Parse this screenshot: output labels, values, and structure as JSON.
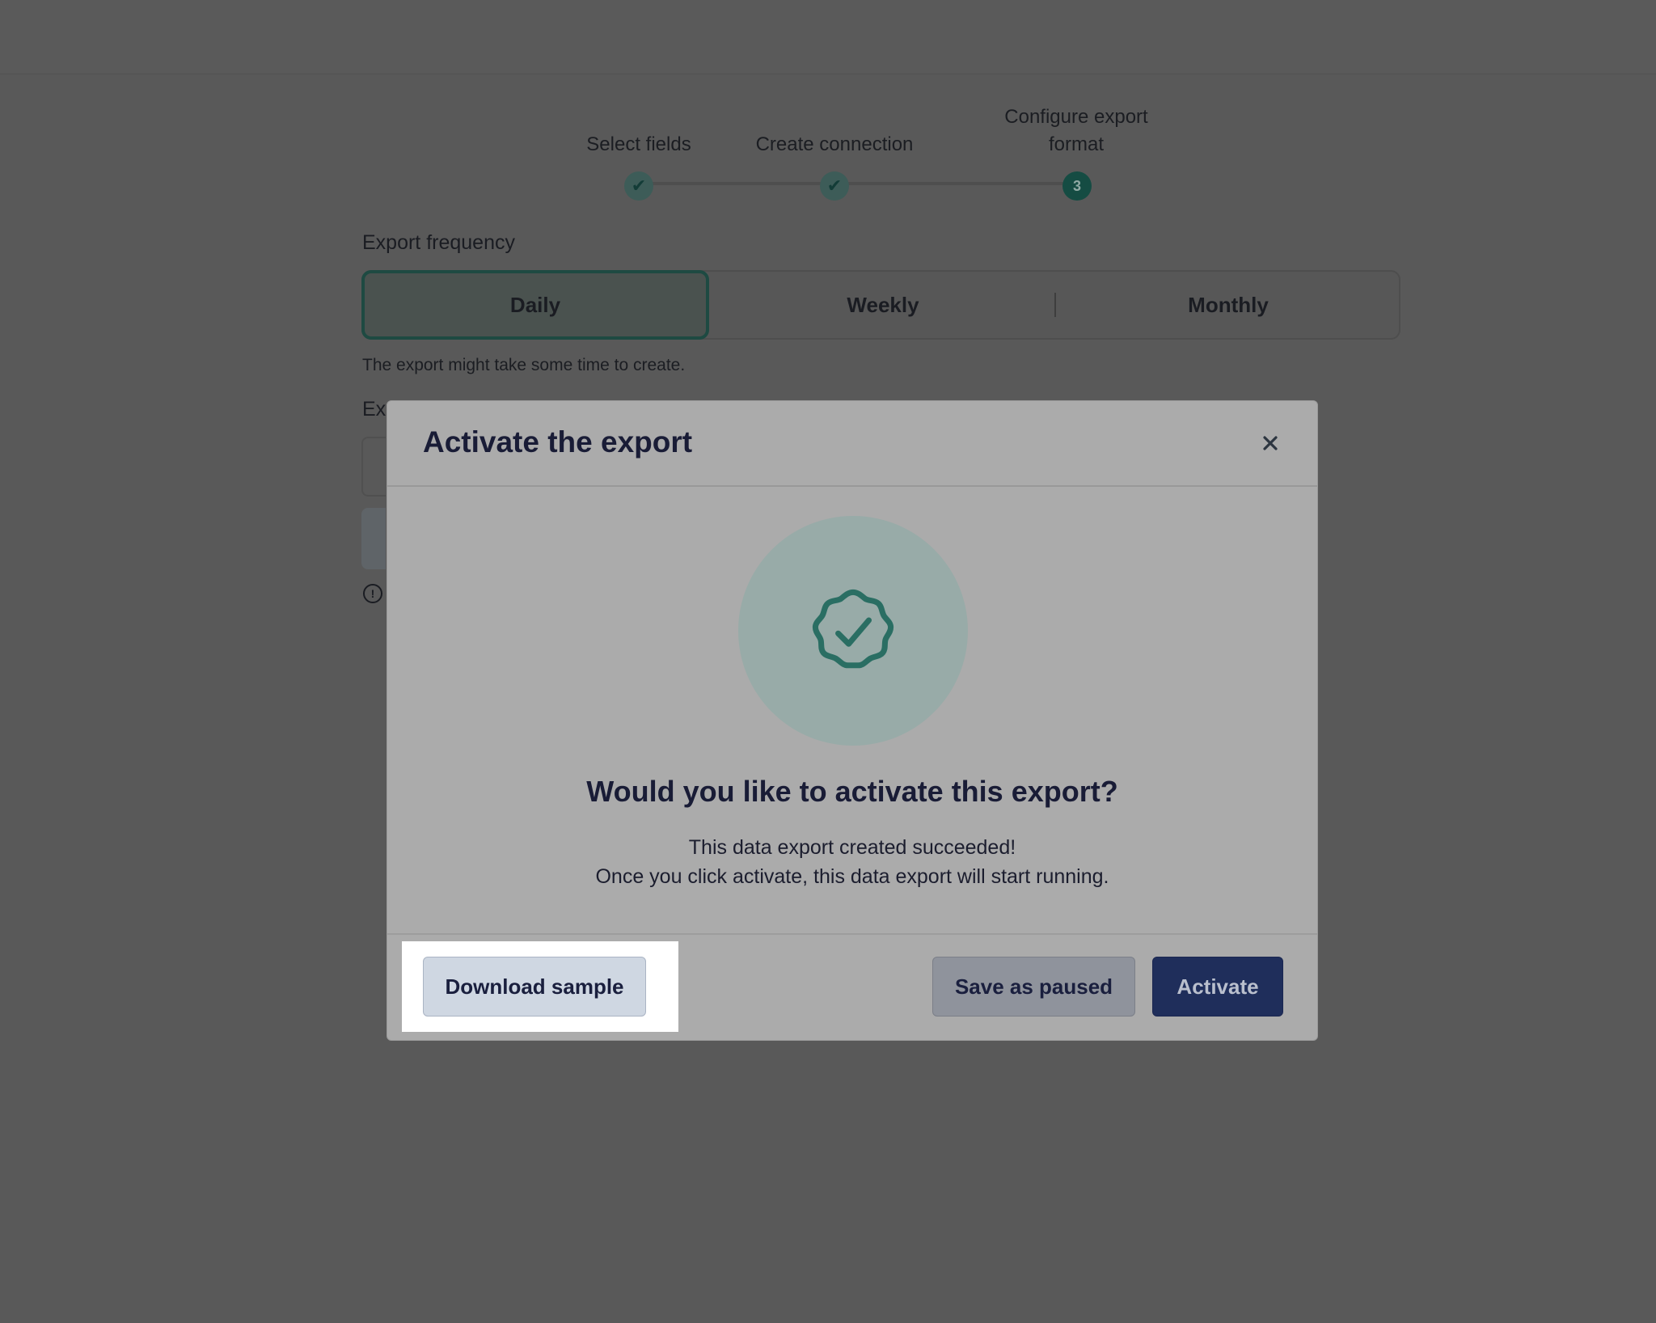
{
  "stepper": {
    "steps": [
      {
        "label": "Select fields",
        "state": "done",
        "marker": "✔"
      },
      {
        "label": "Create connection",
        "state": "done",
        "marker": "✔"
      },
      {
        "label": "Configure export format",
        "state": "current",
        "marker": "3"
      }
    ]
  },
  "form": {
    "frequency_label": "Export frequency",
    "frequency_options": [
      "Daily",
      "Weekly",
      "Monthly"
    ],
    "frequency_selected": "Daily",
    "hint": "The export might take some time to create.",
    "partial_label": "Ex"
  },
  "modal": {
    "title": "Activate the export",
    "close_icon": "close-icon",
    "badge_icon": "badge-check-icon",
    "question": "Would you like to activate this export?",
    "message_line1": "This data export created succeeded!",
    "message_line2": "Once you click activate, this data export will start running.",
    "buttons": {
      "download": "Download sample",
      "save_paused": "Save as paused",
      "activate": "Activate"
    }
  },
  "colors": {
    "overlay": "#595959",
    "modal_bg": "#ababab",
    "accent_green": "#2a6e63",
    "primary_button": "#1f2e5b"
  }
}
